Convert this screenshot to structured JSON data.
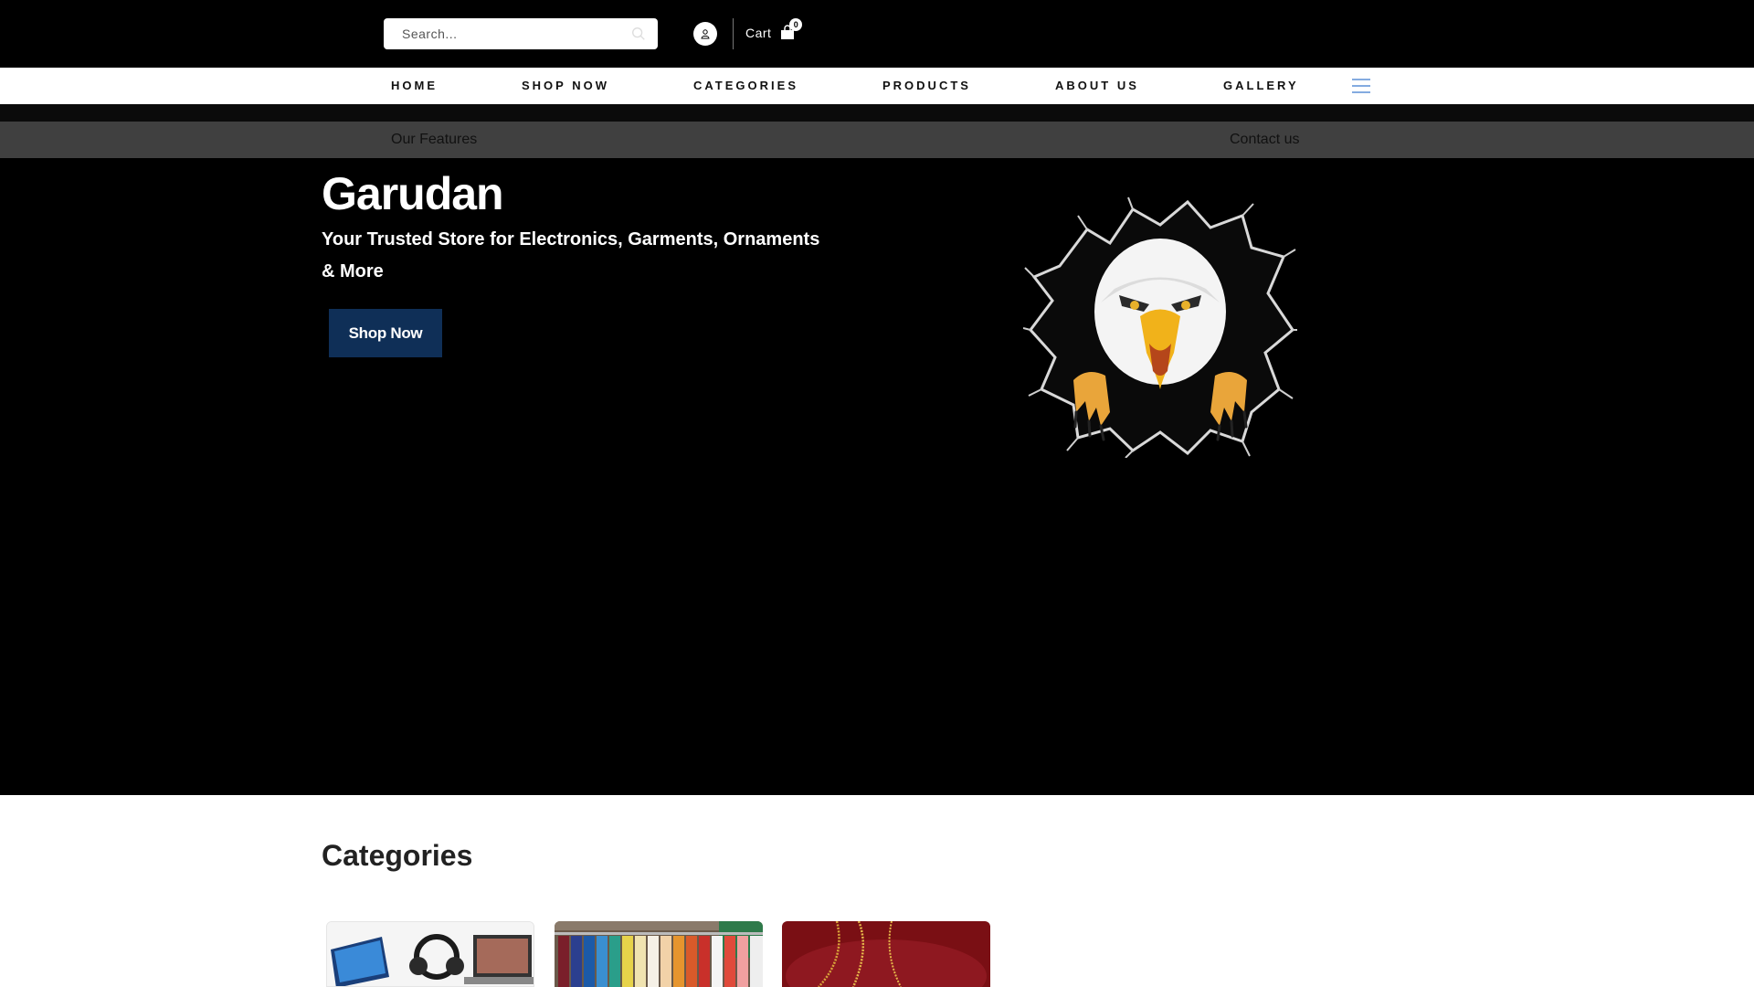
{
  "search": {
    "placeholder": "Search..."
  },
  "header": {
    "cart_label": "Cart",
    "cart_count": "0"
  },
  "nav": {
    "items": [
      {
        "label": "HOME"
      },
      {
        "label": "SHOP NOW"
      },
      {
        "label": "CATEGORIES"
      },
      {
        "label": "PRODUCTS"
      },
      {
        "label": "ABOUT US"
      },
      {
        "label": "GALLERY"
      }
    ]
  },
  "subnav": {
    "features_label": "Our Features",
    "contact_label": "Contact us"
  },
  "hero": {
    "title": "Garudan",
    "subtitle": "Your Trusted Store for Electronics, Garments, Ornaments & More",
    "cta_label": "Shop Now"
  },
  "categories": {
    "heading": "Categories"
  },
  "icons": [
    "search-icon",
    "user-icon",
    "cart-icon",
    "hamburger-icon",
    "eagle-logo"
  ],
  "colors": {
    "topbar": "#000000",
    "subnav": "#404040",
    "cta": "#0f2f57",
    "hero": "#000000"
  }
}
